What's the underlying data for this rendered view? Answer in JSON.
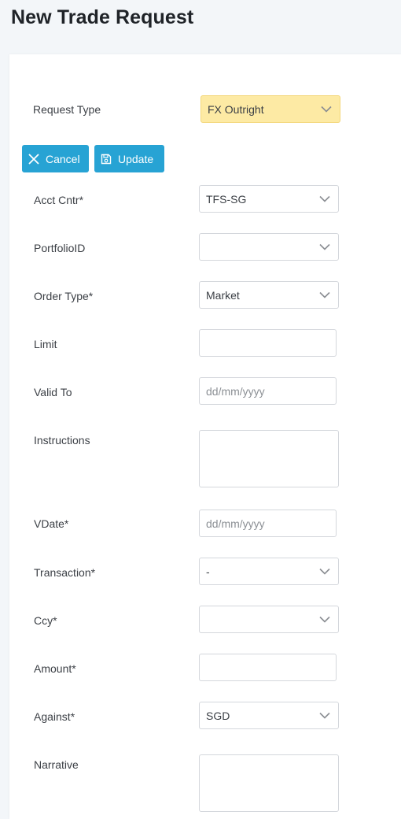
{
  "page": {
    "title": "New Trade Request"
  },
  "request_type": {
    "label": "Request Type",
    "value": "FX Outright"
  },
  "buttons": {
    "cancel": "Cancel",
    "update": "Update"
  },
  "fields": {
    "acct_cntr": {
      "label": "Acct Cntr*",
      "value": "TFS-SG"
    },
    "portfolio": {
      "label": "PortfolioID",
      "value": ""
    },
    "order_type": {
      "label": "Order Type*",
      "value": "Market"
    },
    "limit": {
      "label": "Limit",
      "value": ""
    },
    "valid_to": {
      "label": "Valid To",
      "placeholder": "dd/mm/yyyy"
    },
    "instructions": {
      "label": "Instructions",
      "value": ""
    },
    "vdate": {
      "label": "VDate*",
      "placeholder": "dd/mm/yyyy"
    },
    "transaction": {
      "label": "Transaction*",
      "value": "-"
    },
    "ccy": {
      "label": "Ccy*",
      "value": ""
    },
    "amount": {
      "label": "Amount*",
      "value": ""
    },
    "against": {
      "label": "Against*",
      "value": "SGD"
    },
    "narrative": {
      "label": "Narrative",
      "value": ""
    }
  },
  "colors": {
    "accent": "#27a3d4",
    "highlight": "#fdeaa4",
    "border": "#d4d7dc"
  },
  "icons": {
    "dropdown": "chevron-down-icon",
    "cancel": "close-icon",
    "update": "save-icon"
  }
}
